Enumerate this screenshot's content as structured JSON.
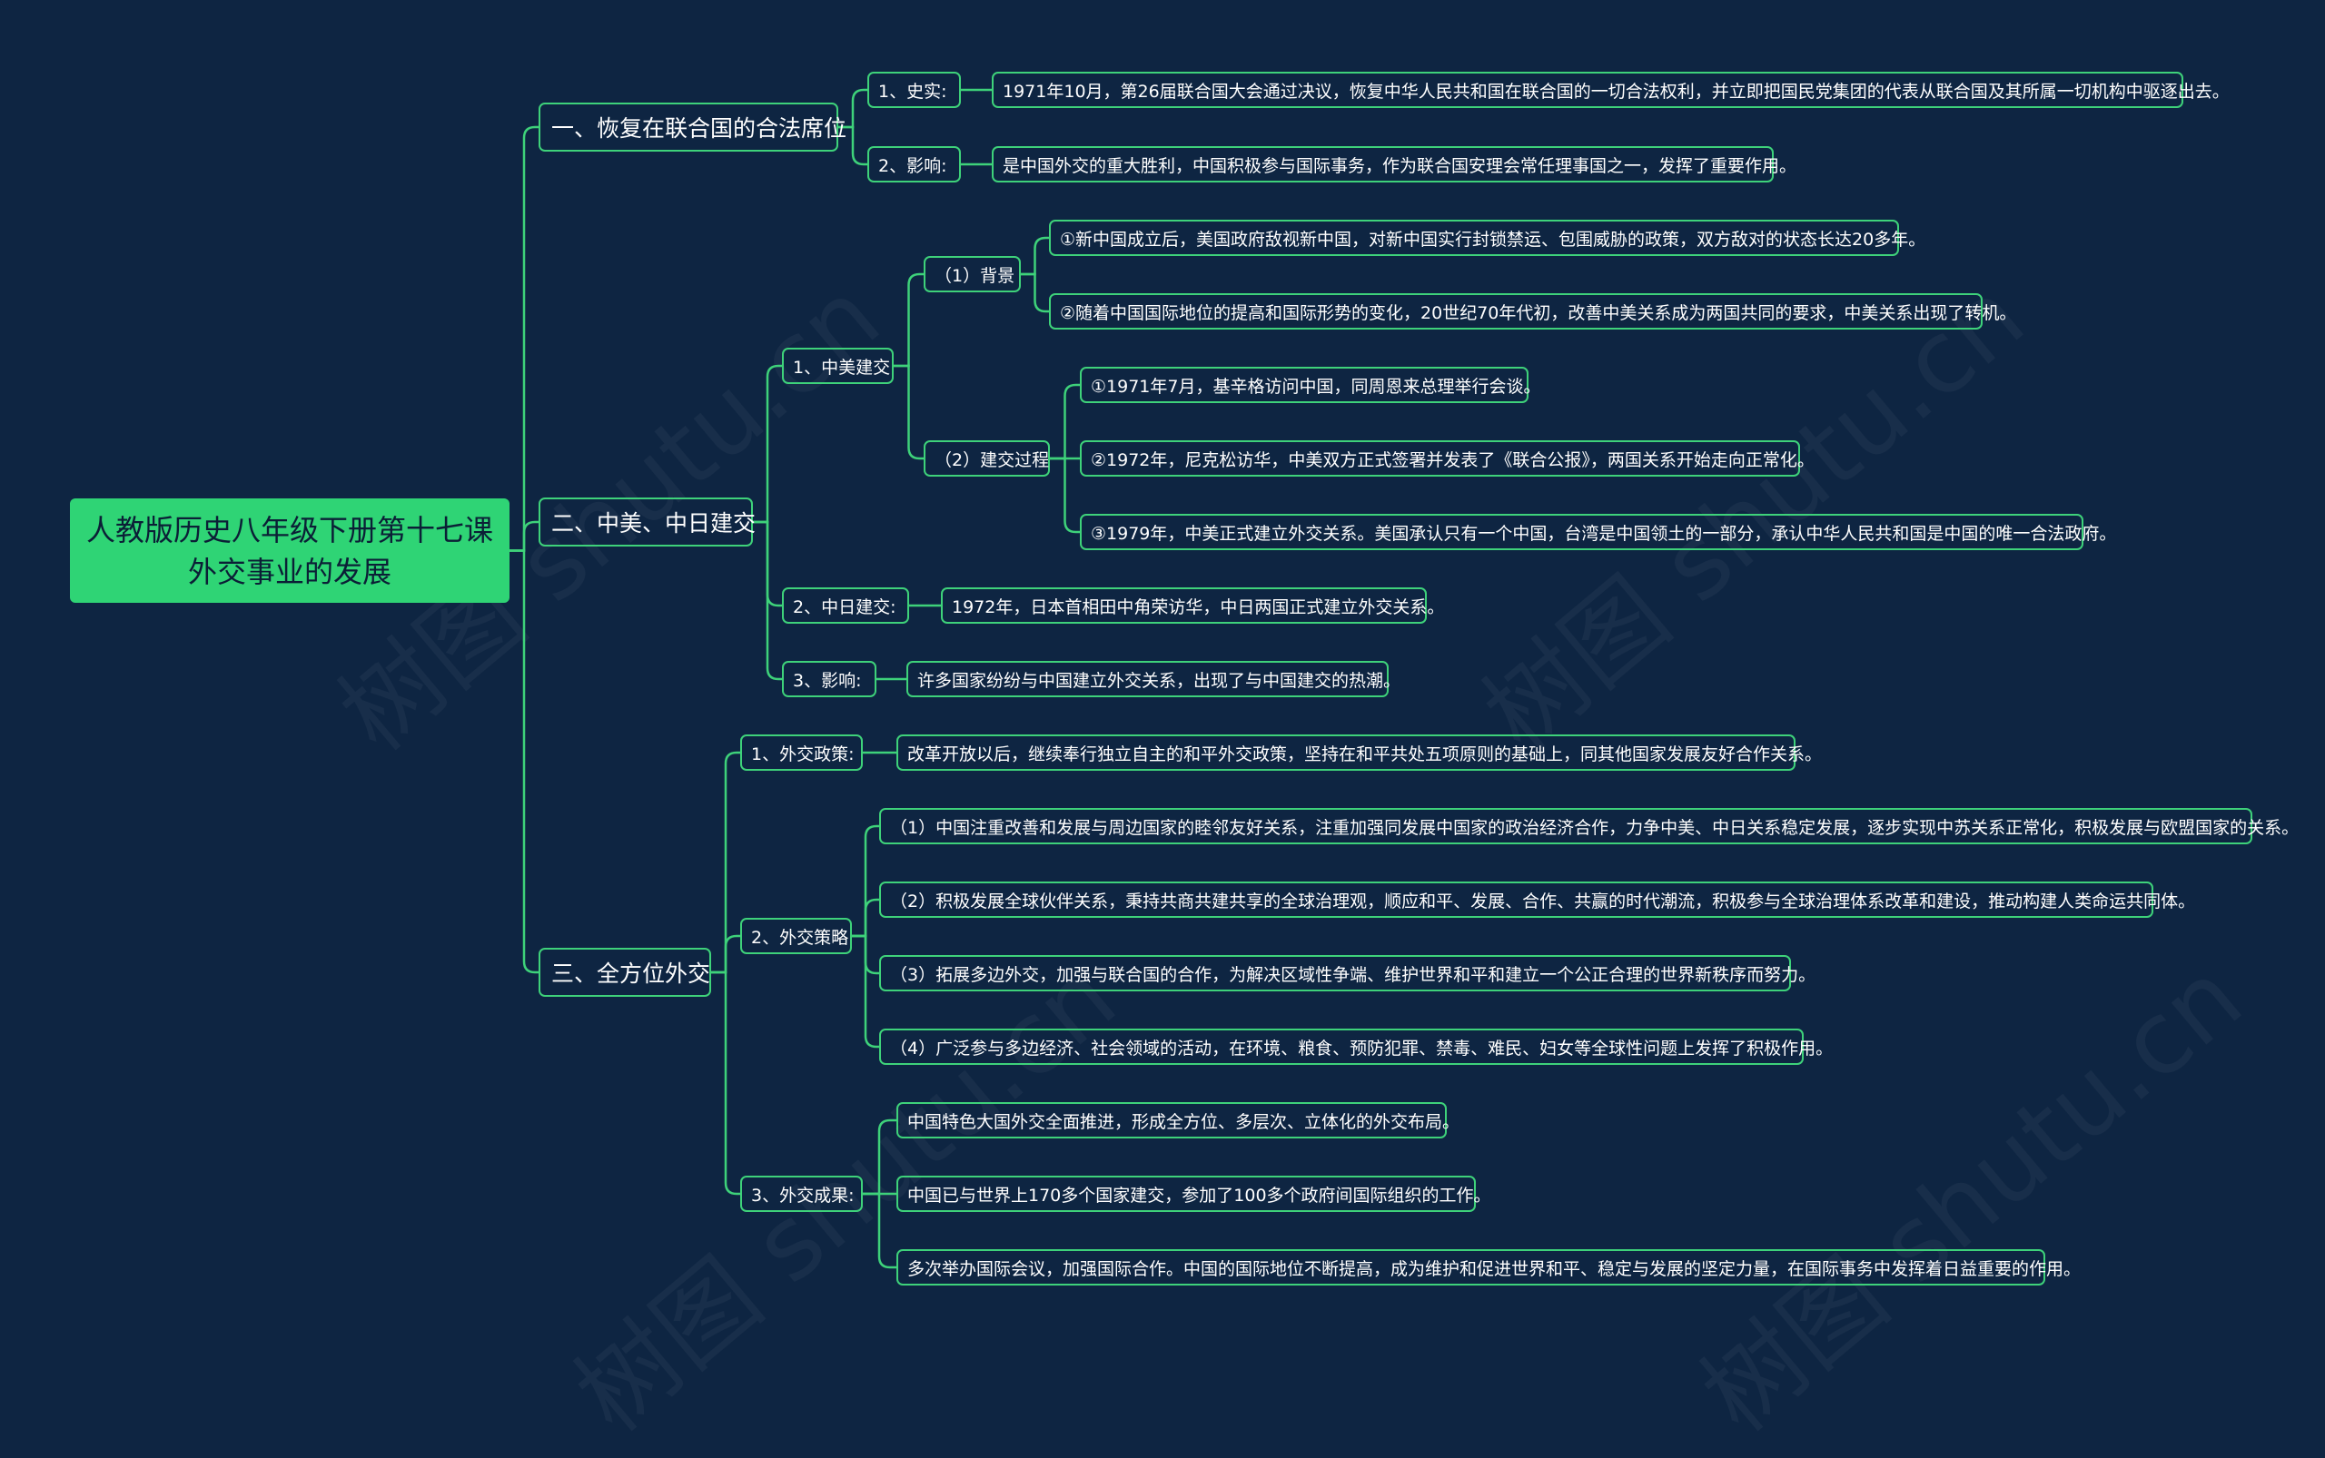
{
  "watermark": "树图 shutu.cn",
  "colors": {
    "background": "#0e2542",
    "line": "#3ed27a",
    "root_fill": "#2fd475"
  },
  "root": {
    "line1": "人教版历史八年级下册第十七课",
    "line2": "外交事业的发展"
  },
  "s1": {
    "label": "一、恢复在联合国的合法席位",
    "a": {
      "label": "1、史实:",
      "text": "1971年10月，第26届联合国大会通过决议，恢复中华人民共和国在联合国的一切合法权利，并立即把国民党集团的代表从联合国及其所属一切机构中驱逐出去。"
    },
    "b": {
      "label": "2、影响:",
      "text": "是中国外交的重大胜利，中国积极参与国际事务，作为联合国安理会常任理事国之一，发挥了重要作用。"
    }
  },
  "s2": {
    "label": "二、中美、中日建交",
    "us": {
      "label": "1、中美建交",
      "bg": {
        "label": "（1）背景",
        "items": [
          "①新中国成立后，美国政府敌视新中国，对新中国实行封锁禁运、包围威胁的政策，双方敌对的状态长达20多年。",
          "②随着中国国际地位的提高和国际形势的变化，20世纪70年代初，改善中美关系成为两国共同的要求，中美关系出现了转机。"
        ]
      },
      "proc": {
        "label": "（2）建交过程",
        "items": [
          "①1971年7月，基辛格访问中国，同周恩来总理举行会谈。",
          "②1972年，尼克松访华，中美双方正式签署并发表了《联合公报》，两国关系开始走向正常化。",
          "③1979年，中美正式建立外交关系。美国承认只有一个中国，台湾是中国领土的一部分，承认中华人民共和国是中国的唯一合法政府。"
        ]
      }
    },
    "jp": {
      "label": "2、中日建交:",
      "text": "1972年，日本首相田中角荣访华，中日两国正式建立外交关系。"
    },
    "impact": {
      "label": "3、影响:",
      "text": "许多国家纷纷与中国建立外交关系，出现了与中国建交的热潮。"
    }
  },
  "s3": {
    "label": "三、全方位外交",
    "policy": {
      "label": "1、外交政策:",
      "text": "改革开放以后，继续奉行独立自主的和平外交政策，坚持在和平共处五项原则的基础上，同其他国家发展友好合作关系。"
    },
    "strategy": {
      "label": "2、外交策略",
      "items": [
        "（1）中国注重改善和发展与周边国家的睦邻友好关系，注重加强同发展中国家的政治经济合作，力争中美、中日关系稳定发展，逐步实现中苏关系正常化，积极发展与欧盟国家的关系。",
        "（2）积极发展全球伙伴关系，秉持共商共建共享的全球治理观，顺应和平、发展、合作、共赢的时代潮流，积极参与全球治理体系改革和建设，推动构建人类命运共同体。",
        "（3）拓展多边外交，加强与联合国的合作，为解决区域性争端、维护世界和平和建立一个公正合理的世界新秩序而努力。",
        "（4）广泛参与多边经济、社会领域的活动，在环境、粮食、预防犯罪、禁毒、难民、妇女等全球性问题上发挥了积极作用。"
      ]
    },
    "results": {
      "label": "3、外交成果:",
      "items": [
        "中国特色大国外交全面推进，形成全方位、多层次、立体化的外交布局。",
        "中国已与世界上170多个国家建交，参加了100多个政府间国际组织的工作。",
        "多次举办国际会议，加强国际合作。中国的国际地位不断提高，成为维护和促进世界和平、稳定与发展的坚定力量，在国际事务中发挥着日益重要的作用。"
      ]
    }
  }
}
